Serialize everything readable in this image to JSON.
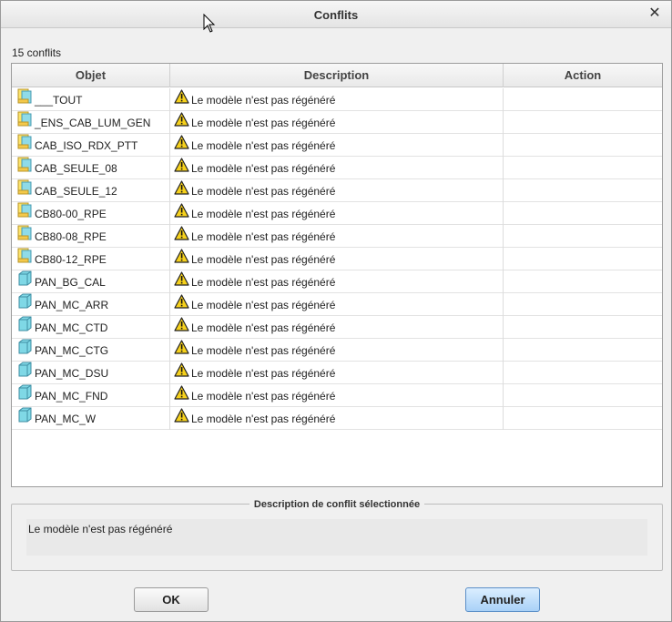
{
  "window": {
    "title": "Conflits",
    "close_symbol": "✕"
  },
  "summary": {
    "count_text": "15 conflits"
  },
  "table": {
    "columns": [
      "Objet",
      "Description",
      "Action"
    ],
    "rows": [
      {
        "object": "___TOUT",
        "type": "assembly",
        "description": "Le modèle n'est pas régénéré",
        "action": ""
      },
      {
        "object": "_ENS_CAB_LUM_GEN",
        "type": "assembly",
        "description": "Le modèle n'est pas régénéré",
        "action": ""
      },
      {
        "object": "CAB_ISO_RDX_PTT",
        "type": "assembly",
        "description": "Le modèle n'est pas régénéré",
        "action": ""
      },
      {
        "object": "CAB_SEULE_08",
        "type": "assembly",
        "description": "Le modèle n'est pas régénéré",
        "action": ""
      },
      {
        "object": "CAB_SEULE_12",
        "type": "assembly",
        "description": "Le modèle n'est pas régénéré",
        "action": ""
      },
      {
        "object": "CB80-00_RPE",
        "type": "assembly",
        "description": "Le modèle n'est pas régénéré",
        "action": ""
      },
      {
        "object": "CB80-08_RPE",
        "type": "assembly",
        "description": "Le modèle n'est pas régénéré",
        "action": ""
      },
      {
        "object": "CB80-12_RPE",
        "type": "assembly",
        "description": "Le modèle n'est pas régénéré",
        "action": ""
      },
      {
        "object": "PAN_BG_CAL",
        "type": "part",
        "description": "Le modèle n'est pas régénéré",
        "action": ""
      },
      {
        "object": "PAN_MC_ARR",
        "type": "part",
        "description": "Le modèle n'est pas régénéré",
        "action": ""
      },
      {
        "object": "PAN_MC_CTD",
        "type": "part",
        "description": "Le modèle n'est pas régénéré",
        "action": ""
      },
      {
        "object": "PAN_MC_CTG",
        "type": "part",
        "description": "Le modèle n'est pas régénéré",
        "action": ""
      },
      {
        "object": "PAN_MC_DSU",
        "type": "part",
        "description": "Le modèle n'est pas régénéré",
        "action": ""
      },
      {
        "object": "PAN_MC_FND",
        "type": "part",
        "description": "Le modèle n'est pas régénéré",
        "action": ""
      },
      {
        "object": "PAN_MC_W",
        "type": "part",
        "description": "Le modèle n'est pas régénéré",
        "action": ""
      }
    ]
  },
  "selected_conflict": {
    "label": "Description de conflit sélectionnée",
    "text": "Le modèle n'est pas régénéré"
  },
  "buttons": {
    "ok": "OK",
    "cancel": "Annuler"
  },
  "icons": {
    "assembly": "assembly-icon",
    "part": "part-icon",
    "warning": "warning-icon",
    "cursor": "mouse-pointer-icon"
  },
  "colors": {
    "accent": "#a9d1f7",
    "warning": "#f6d11c",
    "part": "#7fd8e6"
  }
}
